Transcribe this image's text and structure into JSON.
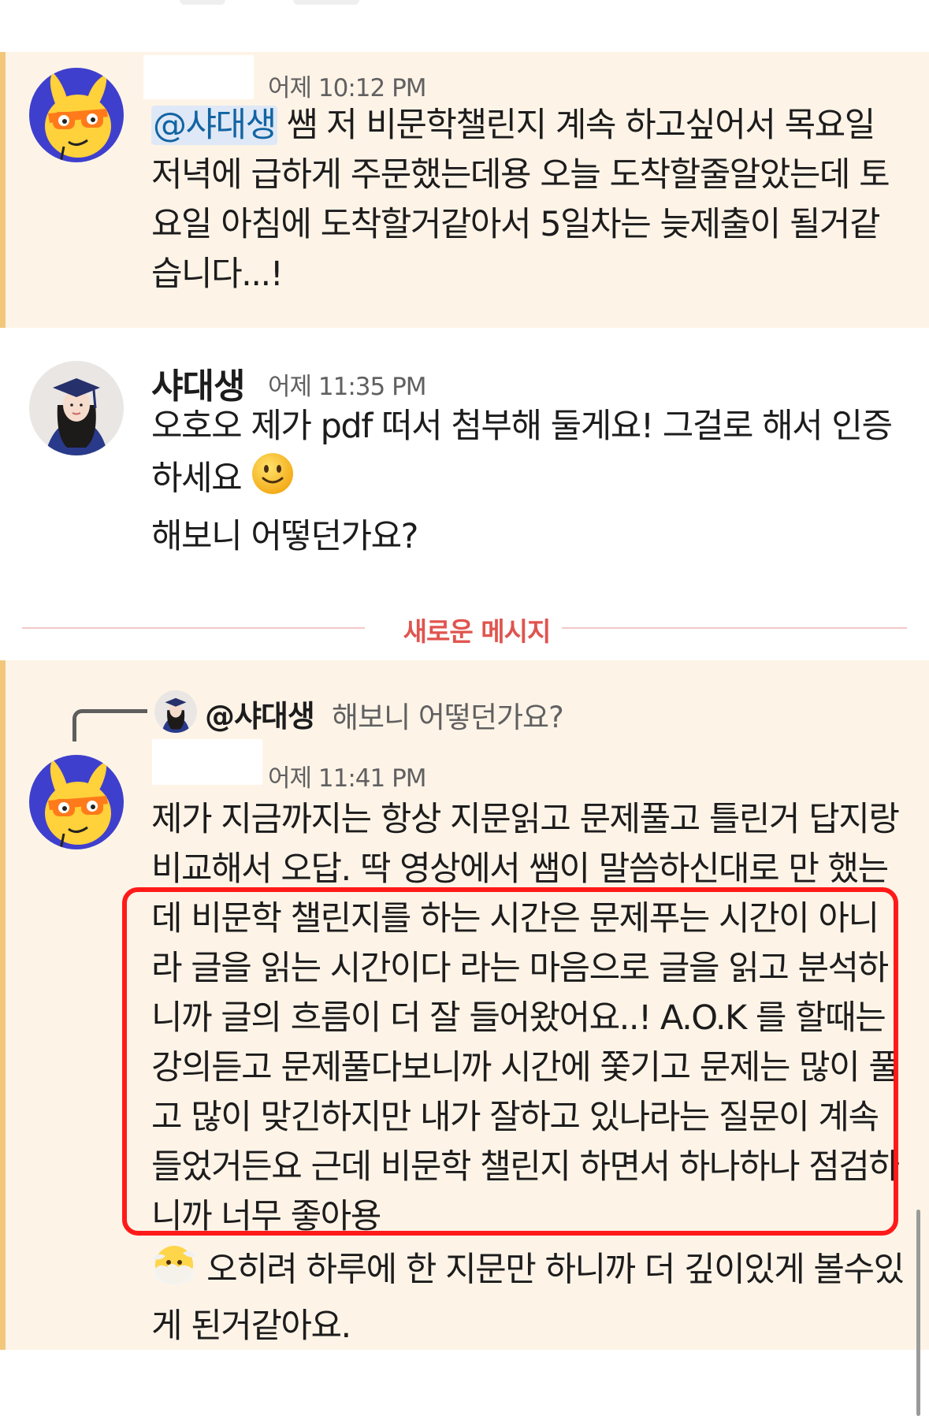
{
  "messages": [
    {
      "time": "어제 10:12 PM",
      "mention": "@샤대생",
      "text": " 쌤 저 비문학챌린지 계속 하고싶어서 목요일 저녁에 급하게 주문했는데용 오늘 도착할줄알았는데 토요일 아침에 도착할거같아서 5일차는 늦제출이 될거같습니다...!"
    },
    {
      "sender": "샤대생",
      "time": "어제 11:35 PM",
      "text1": "오호오 제가 pdf 떠서 첨부해 둘게요! 그걸로 해서 인증하세요",
      "text2": "해보니 어떻던가요?"
    },
    {
      "reply_to_mention": "@샤대생",
      "reply_to_text": "해보니 어떻던가요?",
      "time": "어제 11:41 PM",
      "text_before": "제가 지금까지는 항상 지문읽고 문제풀고 틀린거 답지랑 비교해서 오답. 딱 영상에서 쌤이 말씀하신대로",
      "text_highlighted": "만 했는데 비문학 챌린지를 하는 시간은 문제푸는 시간이 아니라 글을 읽는 시간이다 라는 마음으로 글을 읽고 분석하니까 글의 흐름이 더 잘 들어왔어요..! A.O.K 를 할때는 강의듣고 문제풀다보니까 시간에 쫓기고 문제는 많이 풀고 많이 맞긴하지만 내가 잘하고 있나라는 질문이 계속 들었거든요 근데 비문학 챌린지 하면서 하나하나 점검하니까 너무 좋아용",
      "text_after": " 오히려 하루에 한 지문만 하니까 더 깊이있게 볼수있게 된거같아요."
    }
  ],
  "divider_label": "새로운 메시지",
  "icons": {
    "mascot": "bunny-mascot-icon",
    "grad": "graduate-photo-icon",
    "smile": "slightly-smiling-face-icon",
    "cloud": "face-in-clouds-icon"
  },
  "colors": {
    "highlight_bg": "#fdf4e7",
    "highlight_bar": "#f2c77b",
    "mention_bg": "#dfe8f6",
    "mention_fg": "#1264a3",
    "divider": "#e0544f",
    "annotation_box": "#ff1a1a"
  }
}
